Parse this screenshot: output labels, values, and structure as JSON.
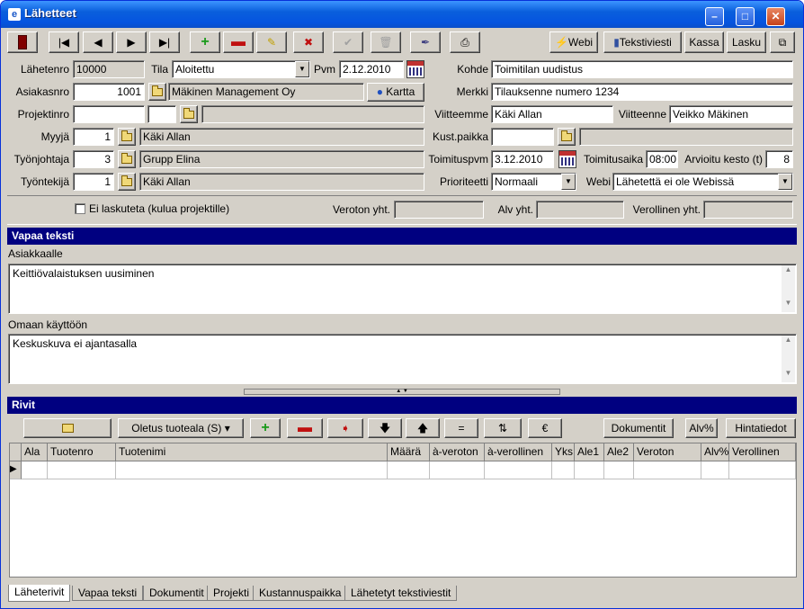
{
  "window": {
    "title": "Lähetteet"
  },
  "toolbar": {
    "webi": "Webi",
    "tekstiviesti": "Tekstiviesti",
    "kassa": "Kassa",
    "lasku": "Lasku"
  },
  "form": {
    "lahetenro_label": "Lähetenro",
    "lahetenro": "10000",
    "tila_label": "Tila",
    "tila": "Aloitettu",
    "pvm_label": "Pvm",
    "pvm": "2.12.2010",
    "kohde_label": "Kohde",
    "kohde": "Toimitilan uudistus",
    "asiakasnro_label": "Asiakasnro",
    "asiakasnro": "1001",
    "asiakas_nimi": "Mäkinen Management Oy",
    "kartta": "Kartta",
    "merkki_label": "Merkki",
    "merkki": "Tilauksenne numero 1234",
    "projektinro_label": "Projektinro",
    "viitteemme_label": "Viitteemme",
    "viitteemme": "Käki Allan",
    "viitteenne_label": "Viitteenne",
    "viitteenne": "Veikko Mäkinen",
    "myyja_label": "Myyjä",
    "myyja_nro": "1",
    "myyja": "Käki Allan",
    "kustpaikka_label": "Kust.paikka",
    "tyonjohtaja_label": "Työnjohtaja",
    "tyonjohtaja_nro": "3",
    "tyonjohtaja": "Grupp Elina",
    "toimituspvm_label": "Toimituspvm",
    "toimituspvm": "3.12.2010",
    "toimitusaika_label": "Toimitusaika",
    "toimitusaika": "08:00",
    "arvioitu_label": "Arvioitu kesto (t)",
    "arvioitu": "8",
    "tyontekija_label": "Työntekijä",
    "tyontekija_nro": "1",
    "tyontekija": "Käki Allan",
    "prioriteetti_label": "Prioriteetti",
    "prioriteetti": "Normaali",
    "webi_label": "Webi",
    "webi": "Lähetettä ei ole Webissä",
    "ei_laskuteta": "Ei laskuteta (kulua projektille)",
    "veroton_label": "Veroton yht.",
    "alv_label": "Alv yht.",
    "verollinen_label": "Verollinen yht."
  },
  "vapaa": {
    "title": "Vapaa teksti",
    "asiakkaalle_label": "Asiakkaalle",
    "asiakkaalle": "Keittiövalaistuksen uusiminen",
    "omaan_label": "Omaan käyttöön",
    "omaan": "Keskuskuva ei ajantasalla"
  },
  "rivit": {
    "title": "Rivit",
    "oletus": "Oletus tuoteala (S)",
    "dokumentit": "Dokumentit",
    "alvp": "Alv%",
    "hintatiedot": "Hintatiedot",
    "eq": "=",
    "euro": "€",
    "columns": [
      "Ala",
      "Tuotenro",
      "Tuotenimi",
      "Määrä",
      "à-veroton",
      "à-verollinen",
      "Yks",
      "Ale1",
      "Ale2",
      "Veroton",
      "Alv%",
      "Verollinen"
    ]
  },
  "tabs": [
    "Läheterivit",
    "Vapaa teksti",
    "Dokumentit",
    "Projekti",
    "Kustannuspaikka",
    "Lähetetyt tekstiviestit"
  ]
}
